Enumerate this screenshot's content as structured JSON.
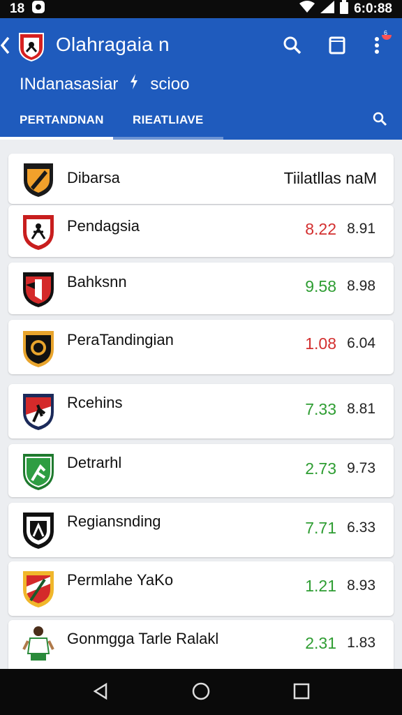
{
  "status_bar": {
    "time_left": "18",
    "time_right": "6:0:88"
  },
  "app_bar": {
    "title": "Olahragaia n",
    "subtitle": "INdanasasiar",
    "subtitle_right": "scioo",
    "notification_count": "6"
  },
  "tabs": [
    {
      "label": "PERTANDNAN",
      "active": true
    },
    {
      "label": "RIEATLIAVE",
      "active": false
    }
  ],
  "header_row": {
    "name": "Dibarsa",
    "right_label": "Tiilatllas naM"
  },
  "teams": [
    {
      "name": "Pendagsia",
      "value1": "8.22",
      "value2": "8.91",
      "value1_color": "#d32f2f",
      "badge": "red-white-runner"
    },
    {
      "name": "Bahksnn",
      "value1": "9.58",
      "value2": "8.98",
      "value1_color": "#2e9d32",
      "badge": "red-black-shield"
    },
    {
      "name": "PeraTandingian",
      "value1": "1.08",
      "value2": "6.04",
      "value1_color": "#d32f2f",
      "badge": "black-orange-ball"
    },
    {
      "name": "Rcehins",
      "value1": "7.33",
      "value2": "8.81",
      "value1_color": "#2e9d32",
      "badge": "red-white-dancer"
    },
    {
      "name": "Detrarhl",
      "value1": "2.73",
      "value2": "9.73",
      "value1_color": "#2e9d32",
      "badge": "green-shield"
    },
    {
      "name": "Regiansnding",
      "value1": "7.71",
      "value2": "6.33",
      "value1_color": "#2e9d32",
      "badge": "black-white-shield"
    },
    {
      "name": "Permlahe YaKo",
      "value1": "1.21",
      "value2": "8.93",
      "value1_color": "#2e9d32",
      "badge": "yellow-red-shield"
    },
    {
      "name": "Gonmgga Tarle Ralakl",
      "value1": "2.31",
      "value2": "1.83",
      "value1_color": "#2e9d32",
      "badge": "player-figure"
    }
  ],
  "colors": {
    "app_bar": "#1f5bbd",
    "up": "#2e9d32",
    "down": "#d32f2f"
  }
}
